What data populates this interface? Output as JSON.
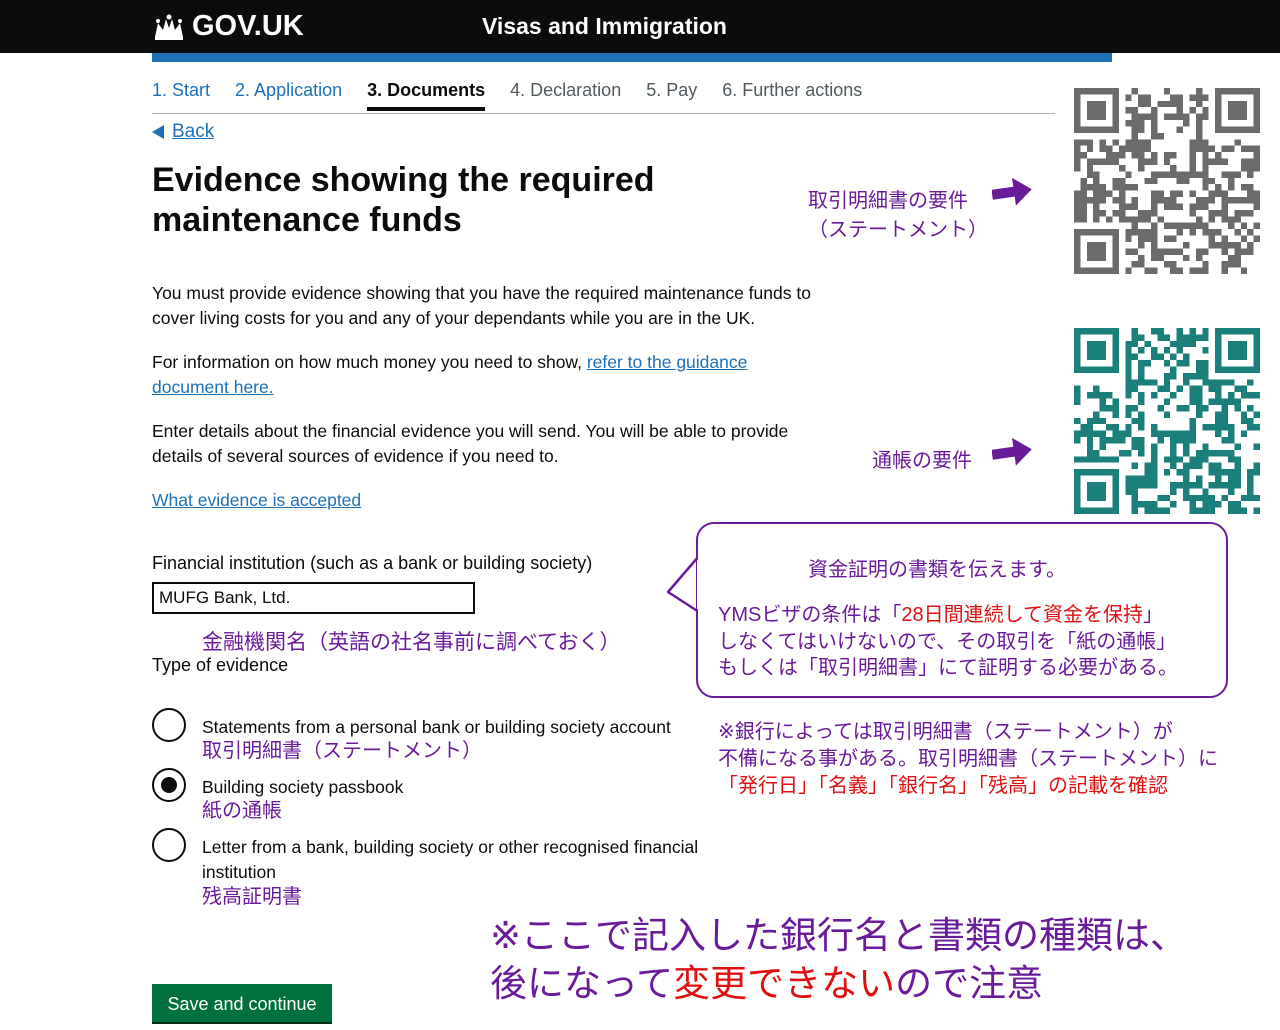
{
  "header": {
    "logo_text": "GOV.UK",
    "service_name": "Visas and Immigration"
  },
  "steps": [
    {
      "label": "1. Start",
      "state": "link"
    },
    {
      "label": "2. Application",
      "state": "link"
    },
    {
      "label": "3. Documents",
      "state": "current"
    },
    {
      "label": "4. Declaration",
      "state": "inactive"
    },
    {
      "label": "5. Pay",
      "state": "inactive"
    },
    {
      "label": "6. Further actions",
      "state": "inactive"
    }
  ],
  "back_label": "Back",
  "page_title": "Evidence showing the required maintenance funds",
  "paragraphs": {
    "p1": "You must provide evidence showing that you have the required maintenance funds to cover living costs for you and any of your dependants while you are in the UK.",
    "p2_text": "For information on how much money you need to show, ",
    "p2_link": "refer to the guidance document here.",
    "p3": "Enter details about the financial evidence you will send. You will be able to provide details of several sources of evidence if you need to.",
    "evidence_link": "What evidence is accepted"
  },
  "form": {
    "institution_label": "Financial institution (such as a bank or building society)",
    "institution_value": "MUFG Bank, Ltd.",
    "type_label": "Type of evidence",
    "options": [
      {
        "label": "Statements from a personal bank or building society account",
        "jp": "取引明細書（ステートメント）",
        "checked": false
      },
      {
        "label": "Building society passbook",
        "jp": "紙の通帳",
        "checked": true
      },
      {
        "label": "Letter from a bank, building society or other recognised financial institution",
        "jp": "残高証明書",
        "checked": false
      }
    ],
    "save_label": "Save and continue"
  },
  "annotations": {
    "statement_req": "取引明細書の要件",
    "statement_req2": "（ステートメント）",
    "passbook_req": "通帳の要件",
    "bank_name_note": "金融機関名（英語の社名事前に調べておく）",
    "callout_title": "資金証明の書類を伝えます。",
    "callout_line1_a": "YMSビザの条件は「",
    "callout_line1_red": "28日間連続して資金を保持",
    "callout_line1_b": "」",
    "callout_line2": "しなくてはいけないので、その取引を「紙の通帳」",
    "callout_line3": "もしくは「取引明細書」にて証明する必要がある。",
    "note_line1": "※銀行によっては取引明細書（ステートメント）が",
    "note_line2": "不備になる事がある。取引明細書（ステートメント）に",
    "note_line3": "「発行日」「名義」「銀行名」「残高」の記載を確認",
    "big_line1": "※ここで記入した銀行名と書類の種類は、",
    "big_line2_a": "後になって",
    "big_line2_red": "変更できない",
    "big_line2_b": "ので注意"
  },
  "colors": {
    "header_bg": "#0b0c0c",
    "brand_blue": "#1d70b8",
    "button_green": "#00703c",
    "annotation_purple": "#6a1b9a",
    "annotation_red": "#e01010",
    "qr_gray": "#6b6b6b",
    "qr_teal": "#1b7f7c"
  }
}
